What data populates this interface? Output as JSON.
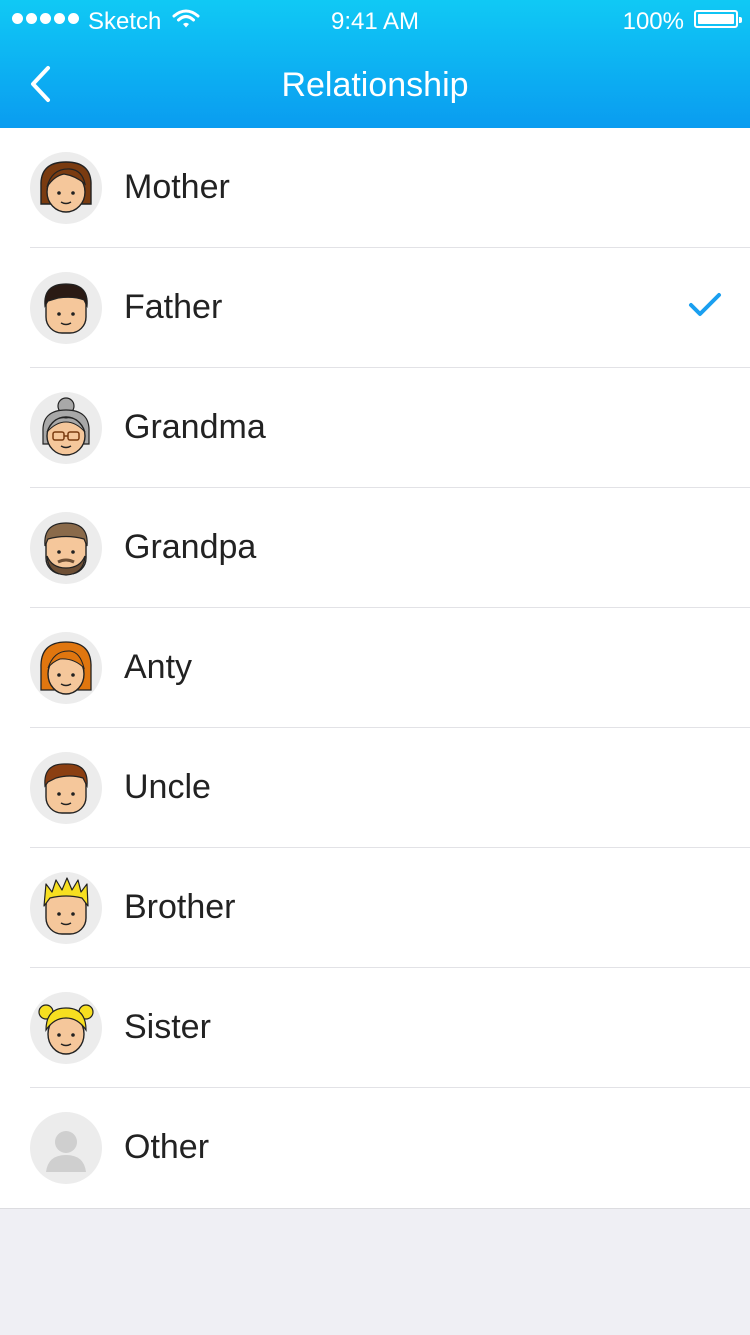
{
  "status_bar": {
    "carrier": "Sketch",
    "time": "9:41 AM",
    "battery": "100%",
    "signal_dots": 5
  },
  "nav": {
    "title": "Relationship",
    "back_icon": "chevron-left-icon"
  },
  "items": [
    {
      "label": "Mother",
      "avatar": "mother-avatar-icon",
      "selected": false
    },
    {
      "label": "Father",
      "avatar": "father-avatar-icon",
      "selected": true
    },
    {
      "label": "Grandma",
      "avatar": "grandma-avatar-icon",
      "selected": false
    },
    {
      "label": "Grandpa",
      "avatar": "grandpa-avatar-icon",
      "selected": false
    },
    {
      "label": "Anty",
      "avatar": "aunt-avatar-icon",
      "selected": false
    },
    {
      "label": "Uncle",
      "avatar": "uncle-avatar-icon",
      "selected": false
    },
    {
      "label": "Brother",
      "avatar": "brother-avatar-icon",
      "selected": false
    },
    {
      "label": "Sister",
      "avatar": "sister-avatar-icon",
      "selected": false
    },
    {
      "label": "Other",
      "avatar": "person-placeholder-icon",
      "selected": false
    }
  ],
  "colors": {
    "header_top": "#10c9f5",
    "header_bottom": "#0a9cf0",
    "check": "#1a9ff0",
    "background": "#efeff4"
  }
}
